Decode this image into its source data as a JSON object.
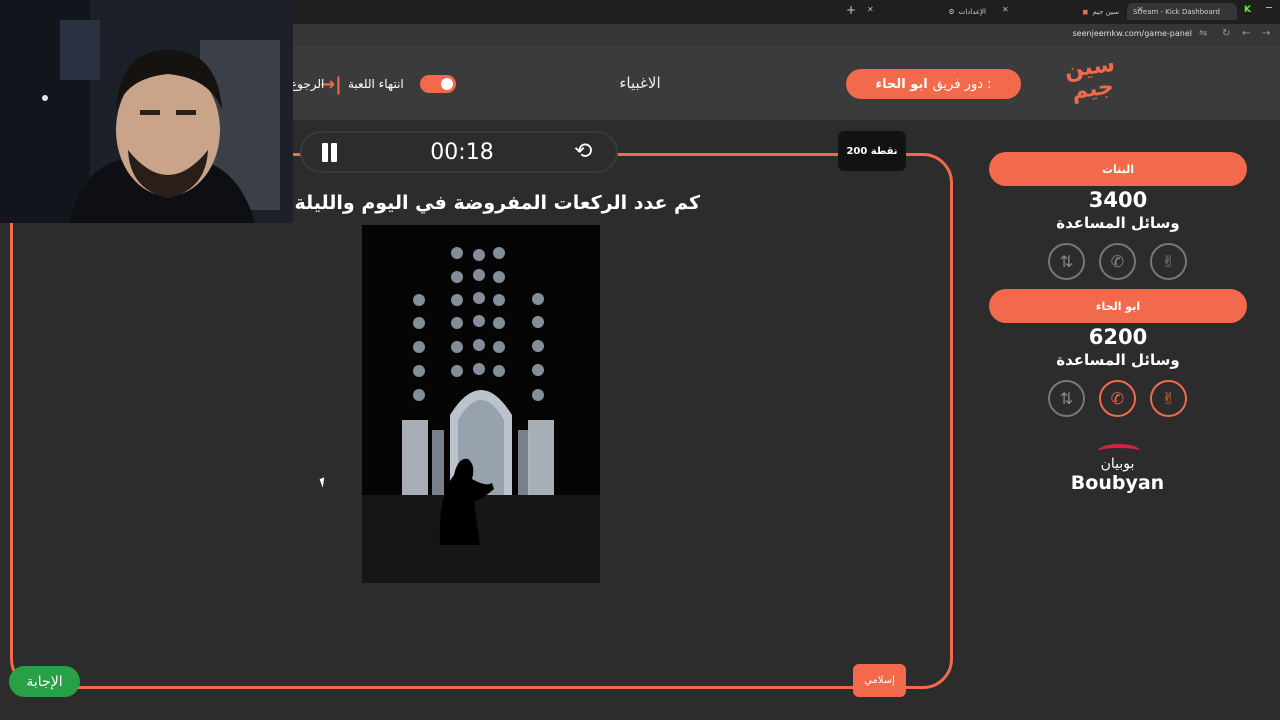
{
  "browser": {
    "tabs": [
      {
        "title": "Stream - Kick Dashboard"
      },
      {
        "title": "سين جيم"
      },
      {
        "title": "الإعدادات"
      }
    ],
    "url": "seenjeemkw.com/game-panel"
  },
  "header": {
    "logo_text": "سين جيم",
    "turn_prefix": "دور فريق :",
    "turn_team": "ابو الحاء",
    "game_name": "الاغبياء",
    "end_game_label": "انتهاء اللعبة",
    "back_label": "الرجوع"
  },
  "question_panel": {
    "timer": "00:18",
    "points": "200 نقطة",
    "question": "كم عدد الركعات المفروضة في اليوم والليلة",
    "category": "إسلامي",
    "answer_button": "الإجابة"
  },
  "teams": [
    {
      "name": "البنات",
      "score": "3400",
      "aids_label": "وسائل المساعدة",
      "aids": [
        {
          "icon": "hand-peace-icon",
          "active": false
        },
        {
          "icon": "phone-icon",
          "active": false
        },
        {
          "icon": "swap-icon",
          "active": false
        }
      ]
    },
    {
      "name": "ابو الحاء",
      "score": "6200",
      "aids_label": "وسائل المساعدة",
      "aids": [
        {
          "icon": "hand-peace-icon",
          "active": true
        },
        {
          "icon": "phone-icon",
          "active": true
        },
        {
          "icon": "swap-icon",
          "active": false
        }
      ]
    }
  ],
  "sponsor": {
    "arabic": "بوبيان",
    "english": "Boubyan"
  },
  "colors": {
    "accent": "#f26a4b",
    "answer_green": "#27a046",
    "panel_bg": "#2c2c2c"
  }
}
